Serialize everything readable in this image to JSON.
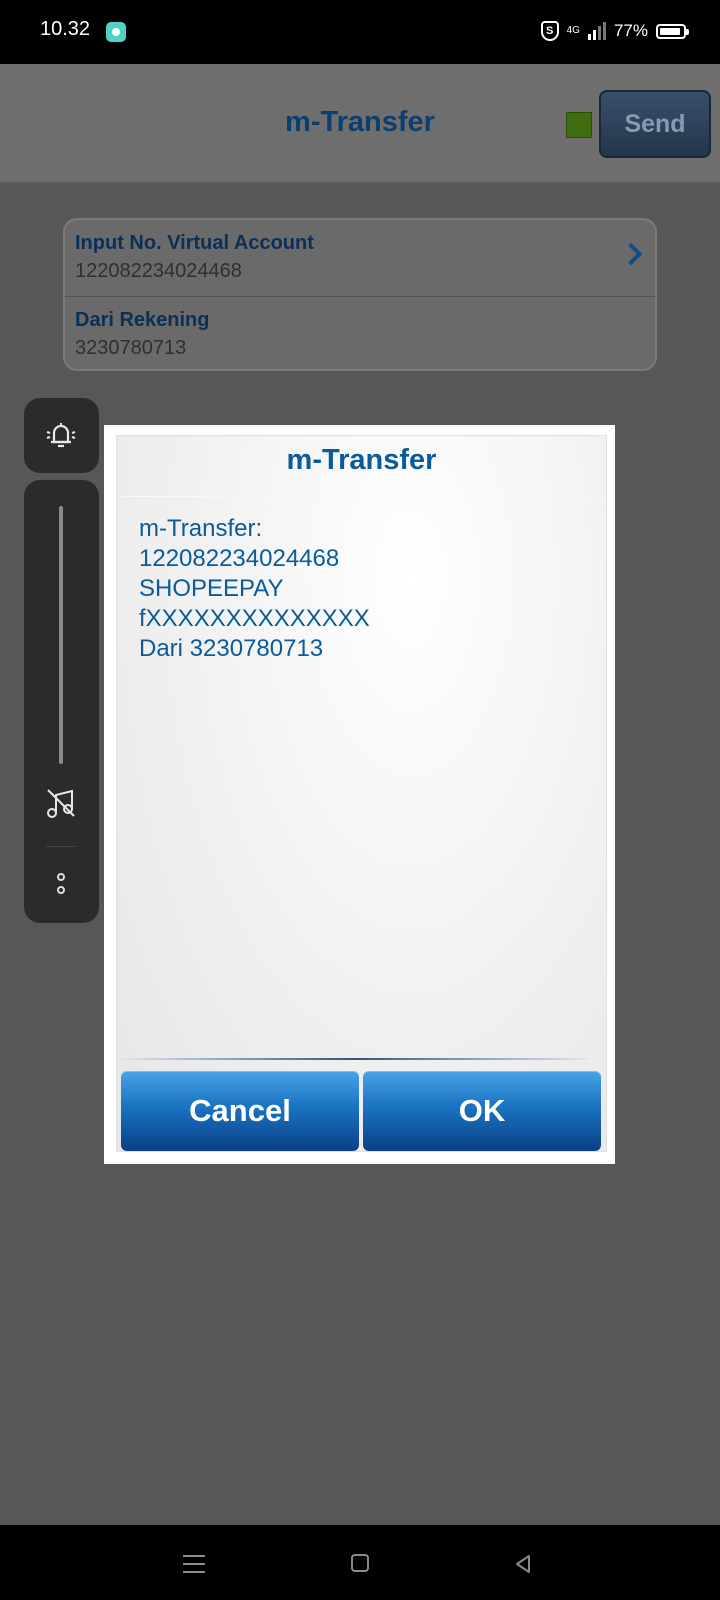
{
  "status_bar": {
    "time": "10.32",
    "network": "4G",
    "battery": "77%",
    "battery_level": 0.77
  },
  "header": {
    "title": "m-Transfer",
    "send_label": "Send",
    "indicator_color": "#3f6e10"
  },
  "form": {
    "rows": [
      {
        "label": "Input No. Virtual Account",
        "value": "122082234024468"
      },
      {
        "label": "Dari Rekening",
        "value": "3230780713"
      }
    ]
  },
  "dialog": {
    "title": "m-Transfer",
    "lines": [
      "m-Transfer:",
      "122082234024468",
      "SHOPEEPAY",
      "fXXXXXXXXXXXXXX",
      "Dari 3230780713"
    ],
    "cancel_label": "Cancel",
    "ok_label": "OK"
  },
  "volume_panel": {
    "icons": [
      "bell-icon",
      "music-off-icon",
      "more-icon"
    ]
  },
  "nav_bar": {
    "icons": [
      "menu-icon",
      "home-icon",
      "back-icon"
    ]
  }
}
